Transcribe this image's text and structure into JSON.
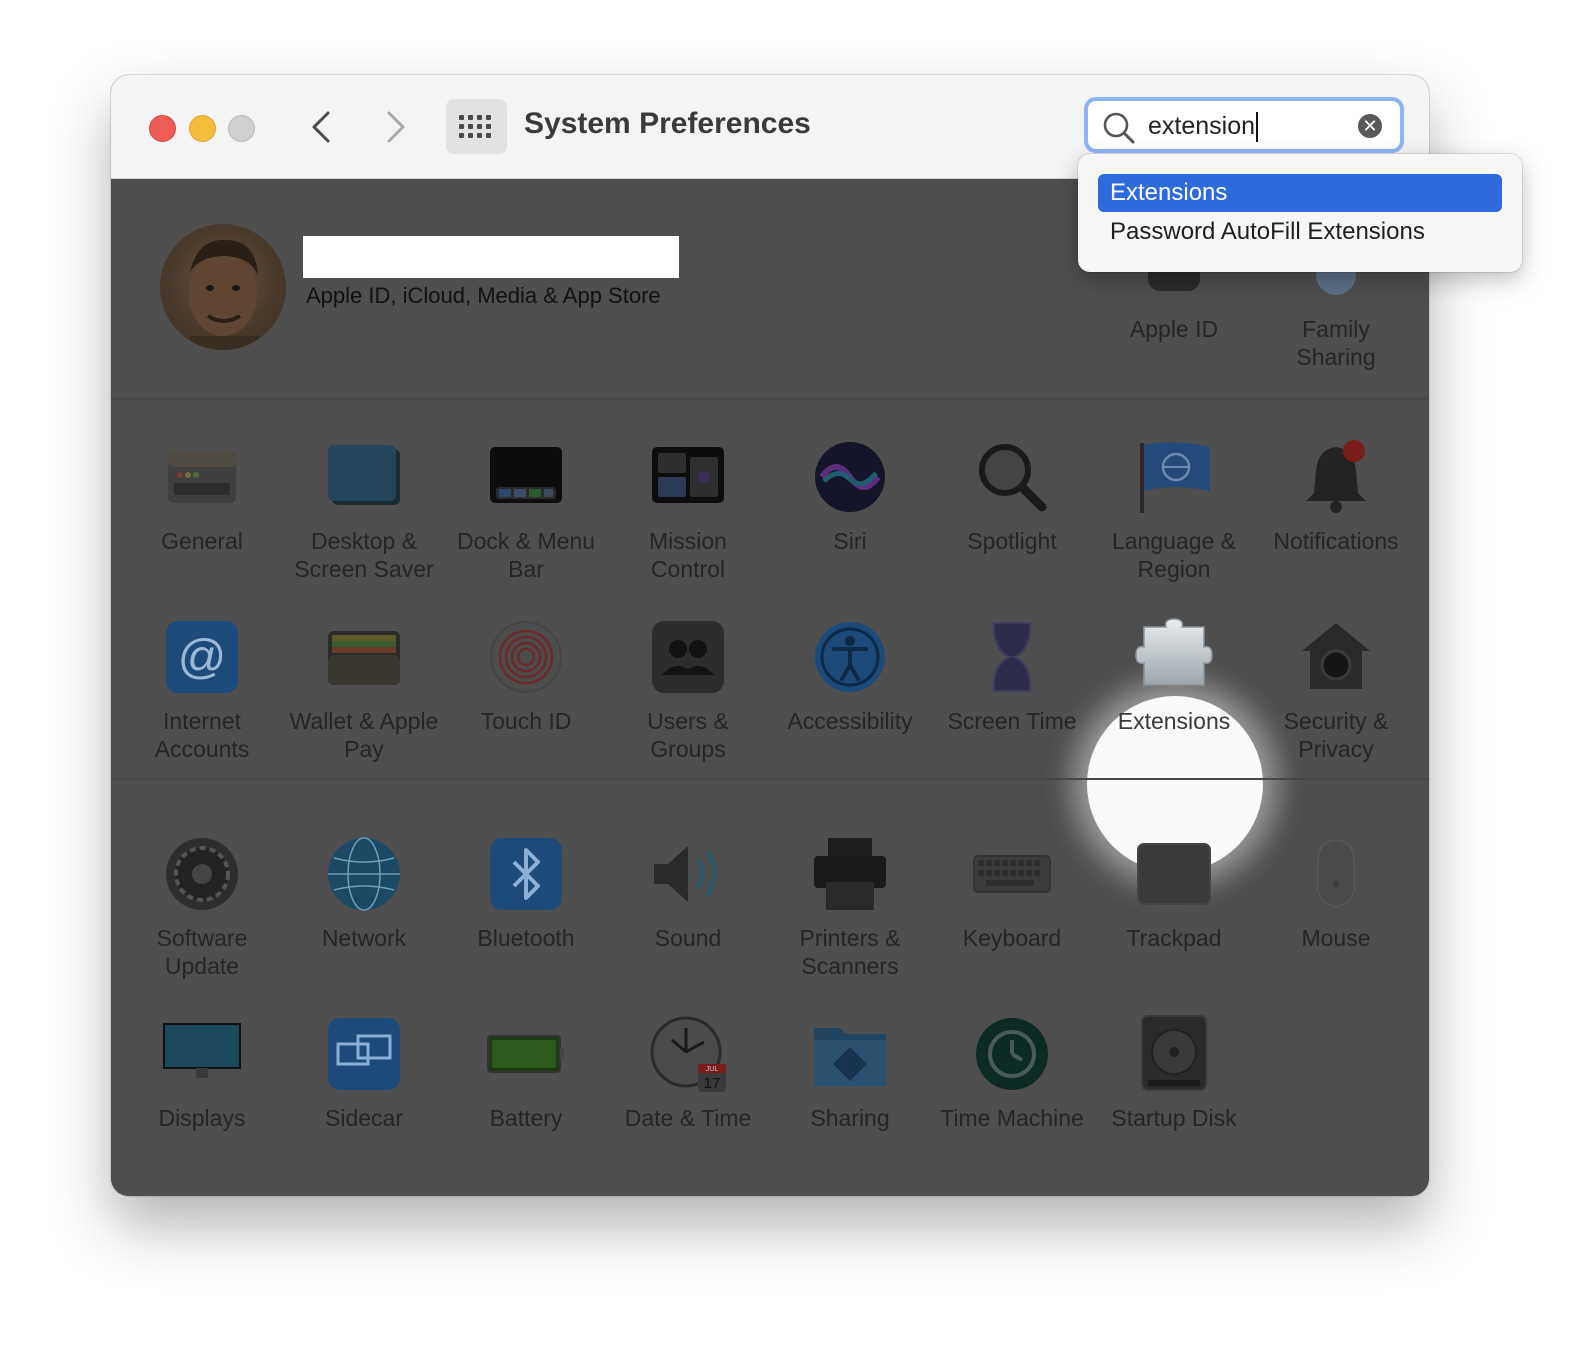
{
  "window": {
    "title": "System Preferences"
  },
  "search": {
    "value": "extension",
    "results": [
      "Extensions",
      "Password AutoFill Extensions"
    ]
  },
  "account": {
    "subtitle": "Apple ID, iCloud, Media & App Store",
    "panes": [
      {
        "label": "Apple ID",
        "icon": "apple-id-icon"
      },
      {
        "label": "Family Sharing",
        "icon": "family-sharing-icon"
      }
    ]
  },
  "rows": [
    [
      {
        "label": "General",
        "icon": "general-icon"
      },
      {
        "label": "Desktop & Screen Saver",
        "icon": "desktop-screensaver-icon"
      },
      {
        "label": "Dock & Menu Bar",
        "icon": "dock-icon"
      },
      {
        "label": "Mission Control",
        "icon": "mission-control-icon"
      },
      {
        "label": "Siri",
        "icon": "siri-icon"
      },
      {
        "label": "Spotlight",
        "icon": "spotlight-icon"
      },
      {
        "label": "Language & Region",
        "icon": "language-region-icon"
      },
      {
        "label": "Notifications",
        "icon": "notifications-icon"
      }
    ],
    [
      {
        "label": "Internet Accounts",
        "icon": "at-sign-icon"
      },
      {
        "label": "Wallet & Apple Pay",
        "icon": "wallet-icon"
      },
      {
        "label": "Touch ID",
        "icon": "fingerprint-icon"
      },
      {
        "label": "Users & Groups",
        "icon": "users-icon"
      },
      {
        "label": "Accessibility",
        "icon": "accessibility-icon"
      },
      {
        "label": "Screen Time",
        "icon": "hourglass-icon"
      },
      {
        "label": "Extensions",
        "icon": "puzzle-piece-icon"
      },
      {
        "label": "Security & Privacy",
        "icon": "security-icon"
      }
    ],
    [
      {
        "label": "Software Update",
        "icon": "gear-icon"
      },
      {
        "label": "Network",
        "icon": "globe-icon"
      },
      {
        "label": "Bluetooth",
        "icon": "bluetooth-icon"
      },
      {
        "label": "Sound",
        "icon": "speaker-icon"
      },
      {
        "label": "Printers & Scanners",
        "icon": "printer-icon"
      },
      {
        "label": "Keyboard",
        "icon": "keyboard-icon"
      },
      {
        "label": "Trackpad",
        "icon": "trackpad-icon"
      },
      {
        "label": "Mouse",
        "icon": "mouse-icon"
      }
    ],
    [
      {
        "label": "Displays",
        "icon": "display-icon"
      },
      {
        "label": "Sidecar",
        "icon": "sidecar-icon"
      },
      {
        "label": "Battery",
        "icon": "battery-icon"
      },
      {
        "label": "Date & Time",
        "icon": "clock-icon"
      },
      {
        "label": "Sharing",
        "icon": "sharing-folder-icon"
      },
      {
        "label": "Time Machine",
        "icon": "time-machine-icon"
      },
      {
        "label": "Startup Disk",
        "icon": "disk-icon"
      }
    ]
  ],
  "calendar": {
    "month": "JUL",
    "day": "17"
  }
}
